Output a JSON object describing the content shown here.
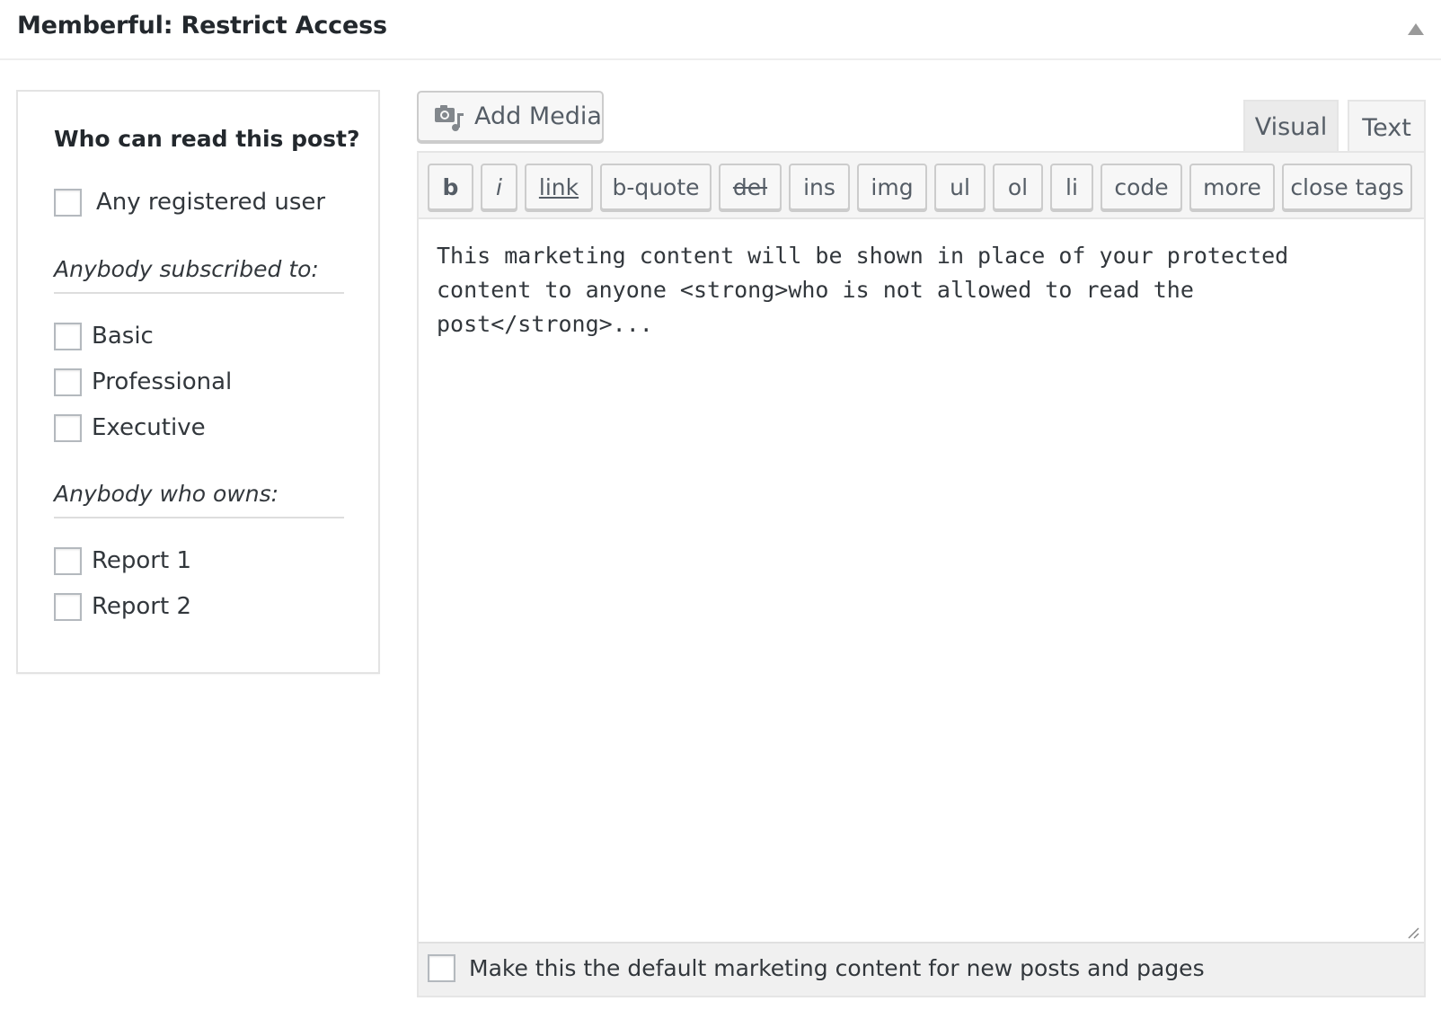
{
  "metabox": {
    "title": "Memberful: Restrict Access"
  },
  "access": {
    "heading": "Who can read this post?",
    "any_registered_label": "Any registered user",
    "subscribed_heading": "Anybody subscribed to:",
    "plans": [
      {
        "label": "Basic",
        "checked": false
      },
      {
        "label": "Professional",
        "checked": false
      },
      {
        "label": "Executive",
        "checked": false
      }
    ],
    "owns_heading": "Anybody who owns:",
    "downloads": [
      {
        "label": "Report 1",
        "checked": false
      },
      {
        "label": "Report 2",
        "checked": false
      }
    ]
  },
  "editor": {
    "add_media_label": "Add Media",
    "tabs": [
      {
        "label": "Visual",
        "active": false
      },
      {
        "label": "Text",
        "active": true
      }
    ],
    "quicktags": [
      "b",
      "i",
      "link",
      "b-quote",
      "del",
      "ins",
      "img",
      "ul",
      "ol",
      "li",
      "code",
      "more",
      "close tags"
    ],
    "content": "This marketing content will be shown in place of your protected\ncontent to anyone <strong>who is not allowed to read the\npost</strong>...",
    "default_checkbox_label": "Make this the default marketing content for new posts and pages"
  },
  "icons": {
    "toggle": "collapse-arrow-icon",
    "add_media": "media-camera-music-icon",
    "resize": "resize-handle-icon"
  },
  "colors": {
    "text": "#23282d",
    "border": "#e5e5e5",
    "button_bg": "#f7f7f7",
    "toolbar_bg": "#f5f5f5"
  }
}
